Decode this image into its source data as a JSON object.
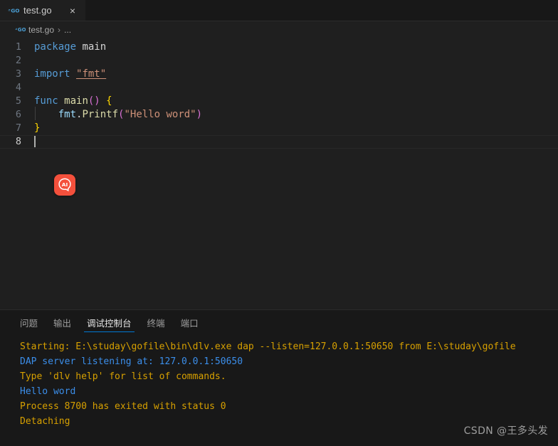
{
  "window": {
    "theme_bg": "#1f1f1f",
    "accent": "#0078d4"
  },
  "tabbar": {
    "tabs": [
      {
        "label": "test.go",
        "icon": "go-lang-icon",
        "close_label": "×",
        "active": true
      }
    ]
  },
  "breadcrumb": {
    "file": "test.go",
    "separator": "›",
    "overflow": "..."
  },
  "editor": {
    "language": "go",
    "lines": [
      {
        "number": "1",
        "text": "package main"
      },
      {
        "number": "2",
        "text": ""
      },
      {
        "number": "3",
        "text": "import \"fmt\""
      },
      {
        "number": "4",
        "text": ""
      },
      {
        "number": "5",
        "text": "func main() {"
      },
      {
        "number": "6",
        "text": "    fmt.Printf(\"Hello word\")"
      },
      {
        "number": "7",
        "text": "}"
      },
      {
        "number": "8",
        "text": ""
      }
    ],
    "tokens": {
      "package_kw": "package",
      "package_name": "main",
      "import_kw": "import",
      "import_path": "\"fmt\"",
      "func_kw": "func",
      "func_name": "main",
      "func_parens": "()",
      "open_brace": "{",
      "close_brace": "}",
      "pkg_ref": "fmt",
      "dot": ".",
      "method": "Printf",
      "lparen": "(",
      "string_arg": "\"Hello word\"",
      "rparen": ")"
    },
    "cursor_line": "8",
    "ai_badge": {
      "icon": "ai-assistant-icon",
      "label": "AI",
      "color": "#f4503c"
    }
  },
  "panel": {
    "tabs": [
      {
        "label": "问题",
        "active": false
      },
      {
        "label": "输出",
        "active": false
      },
      {
        "label": "调试控制台",
        "active": true
      },
      {
        "label": "终端",
        "active": false
      },
      {
        "label": "端口",
        "active": false
      }
    ],
    "console_lines": [
      {
        "text": "Starting: E:\\studay\\gofile\\bin\\dlv.exe dap --listen=127.0.0.1:50650 from E:\\studay\\gofile",
        "color": "yellow"
      },
      {
        "text": "DAP server listening at: 127.0.0.1:50650",
        "color": "blue"
      },
      {
        "text": "Type 'dlv help' for list of commands.",
        "color": "yellow"
      },
      {
        "text": "Hello word",
        "color": "blue"
      },
      {
        "text": "Process 8700 has exited with status 0",
        "color": "yellow"
      },
      {
        "text": "Detaching",
        "color": "yellow"
      }
    ]
  },
  "watermark": {
    "text": "CSDN @王多头发"
  }
}
